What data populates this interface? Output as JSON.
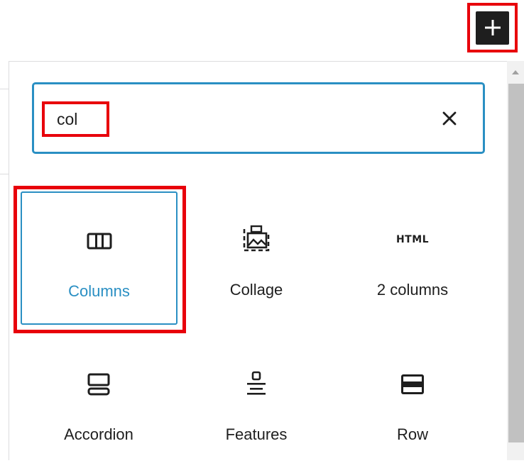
{
  "toolbar": {
    "add_block_icon": "plus-icon",
    "add_block_label": "Add block"
  },
  "search": {
    "value": "col",
    "clear_icon": "close-icon"
  },
  "results": [
    {
      "label": "Columns",
      "icon": "columns-icon",
      "selected": true
    },
    {
      "label": "Collage",
      "icon": "collage-icon",
      "selected": false
    },
    {
      "label": "2 columns",
      "icon": "html-icon",
      "icon_text": "HTML",
      "selected": false
    },
    {
      "label": "Accordion",
      "icon": "accordion-icon",
      "selected": false
    },
    {
      "label": "Features",
      "icon": "features-icon",
      "selected": false
    },
    {
      "label": "Row",
      "icon": "row-icon",
      "selected": false
    }
  ],
  "colors": {
    "accent": "#2a8fc3",
    "highlight": "#e8000b",
    "text": "#1e1e1e"
  }
}
